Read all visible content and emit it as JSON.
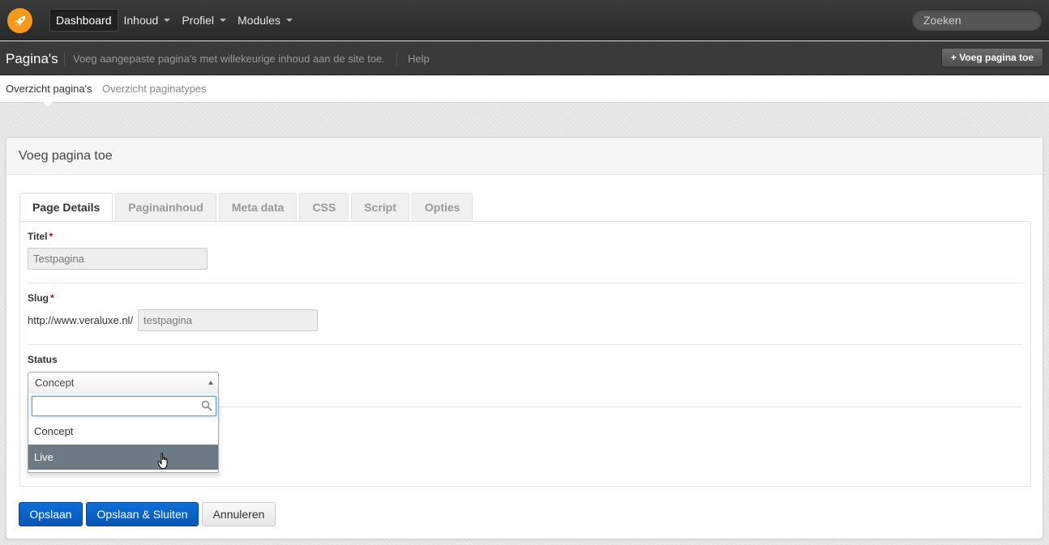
{
  "topnav": {
    "items": [
      {
        "label": "Dashboard",
        "active": true,
        "dropdown": false
      },
      {
        "label": "Inhoud",
        "active": false,
        "dropdown": true
      },
      {
        "label": "Profiel",
        "active": false,
        "dropdown": true
      },
      {
        "label": "Modules",
        "active": false,
        "dropdown": true
      }
    ],
    "search_placeholder": "Zoeken"
  },
  "subheader": {
    "title": "Pagina's",
    "description": "Voeg aangepaste pagina's met willekeurige inhoud aan de site toe.",
    "help": "Help",
    "add_button": "+ Voeg pagina toe"
  },
  "subnav": {
    "items": [
      "Overzicht pagina's",
      "Overzicht paginatypes"
    ]
  },
  "card": {
    "title": "Voeg pagina toe",
    "tabs": [
      "Page Details",
      "Paginainhoud",
      "Meta data",
      "CSS",
      "Script",
      "Opties"
    ],
    "fields": {
      "title": {
        "label": "Titel",
        "required": "*",
        "value": "Testpagina"
      },
      "slug": {
        "label": "Slug",
        "required": "*",
        "prefix": "http://www.veraluxe.nl/",
        "value": "testpagina"
      },
      "status": {
        "label": "Status",
        "selected": "Concept",
        "search_value": "",
        "options": [
          "Concept",
          "Live"
        ],
        "highlighted": "Live"
      }
    },
    "buttons": {
      "save": "Opslaan",
      "save_close": "Opslaan & Sluiten",
      "cancel": "Annuleren"
    }
  },
  "colors": {
    "accent": "#0b62c6",
    "logo": "#f39a1e",
    "highlight": "#6c7a85"
  }
}
